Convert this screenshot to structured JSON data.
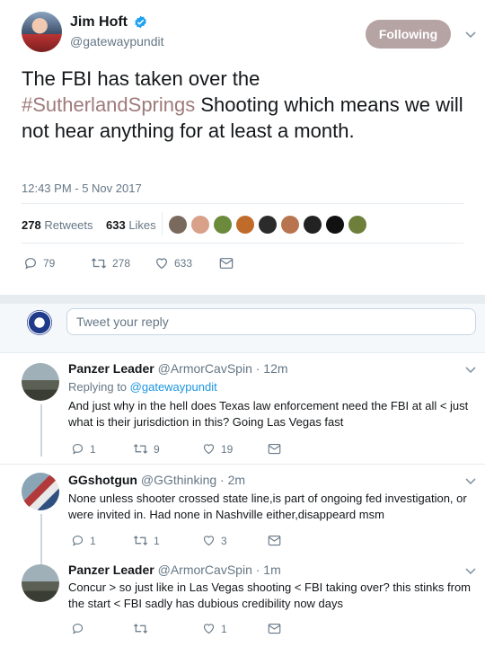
{
  "author": {
    "name": "Jim Hoft",
    "handle": "@gatewaypundit",
    "follow_label": "Following"
  },
  "tweet": {
    "text_before": "The FBI has taken over the",
    "hashtag": "#SutherlandSprings",
    "text_after": "Shooting which means we will not hear anything for at least a month.",
    "timestamp": "12:43 PM - 5 Nov 2017",
    "retweets_count": "278",
    "retweets_label": "Retweets",
    "likes_count": "633",
    "likes_label": "Likes",
    "actions": {
      "replies": "79",
      "retweets": "278",
      "likes": "633"
    }
  },
  "reply_box": {
    "placeholder": "Tweet your reply"
  },
  "replies": [
    {
      "name": "Panzer Leader",
      "handle": "@ArmorCavSpin",
      "time": "· 12m",
      "replying_prefix": "Replying to",
      "replying_to": "@gatewaypundit",
      "text": "And just why in the hell does Texas law enforcement need the FBI at all < just what is their jurisdiction in this? Going Las Vegas fast",
      "replies": "1",
      "retweets": "9",
      "likes": "19"
    },
    {
      "name": "GGshotgun",
      "handle": "@GGthinking",
      "time": "· 2m",
      "text": "None unless shooter crossed state line,is part of ongoing fed investigation, or were invited in. Had none in Nashville either,disappeard msm",
      "replies": "1",
      "retweets": "1",
      "likes": "3"
    },
    {
      "name": "Panzer Leader",
      "handle": "@ArmorCavSpin",
      "time": "· 1m",
      "text": "Concur > so just like in Las Vegas shooting < FBI taking over? this stinks from the start < FBI sadly has dubious credibility now days",
      "replies": "",
      "retweets": "",
      "likes": "1"
    }
  ],
  "colors": {
    "link": "#1b95e0",
    "hashtag": "#9f7a7a",
    "following_btn": "#b6a3a3",
    "muted": "#657786"
  }
}
